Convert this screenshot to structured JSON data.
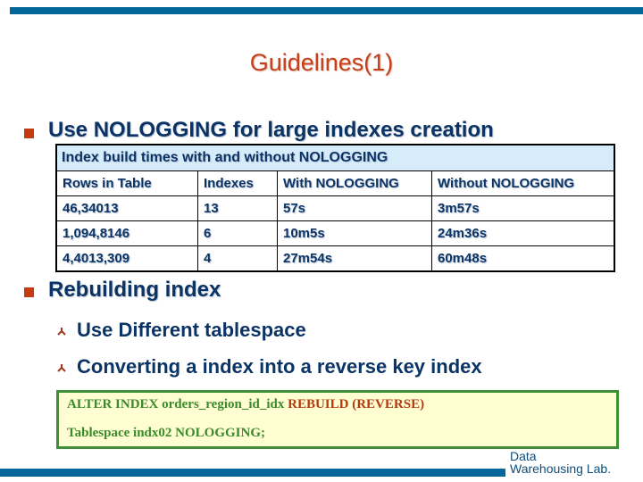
{
  "slide": {
    "title": "Guidelines(1)",
    "bullets": [
      {
        "text": "Use NOLOGGING for large indexes creation"
      },
      {
        "text": "Rebuilding index",
        "subbullets": [
          {
            "text": "Use Different tablespace"
          },
          {
            "text": "Converting a index into a reverse key index"
          }
        ]
      }
    ],
    "table": {
      "caption": "Index build times with and without NOLOGGING",
      "columns": [
        "Rows in Table",
        "Indexes",
        "With NOLOGGING",
        "Without NOLOGGING"
      ],
      "rows": [
        [
          "46,34013",
          "13",
          "57s",
          "3m57s"
        ],
        [
          "1,094,8146",
          "6",
          "10m5s",
          "24m36s"
        ],
        [
          "4,4013,309",
          "4",
          "27m54s",
          "60m48s"
        ]
      ]
    },
    "code": {
      "line1_green": "ALTER INDEX orders_region_id_idx ",
      "line1_red": "REBUILD (REVERSE)",
      "line2": "Tablespace indx02 NOLOGGING;"
    },
    "footer": {
      "line1": "Data",
      "line2": "Warehousing Lab."
    },
    "icons": {
      "level1_bullet": "square-bullet-icon",
      "level2_bullet": "tripod-bullet-icon"
    },
    "colors": {
      "brand_bar": "#056699",
      "title": "#c3401a",
      "text": "#0b3465",
      "bullet": "#c63a12",
      "code_bg": "#fefed2",
      "code_border": "#3f8f37",
      "code_green": "#3b8a2b",
      "code_red": "#b33b10",
      "table_caption_bg": "#d6ecfb"
    }
  }
}
